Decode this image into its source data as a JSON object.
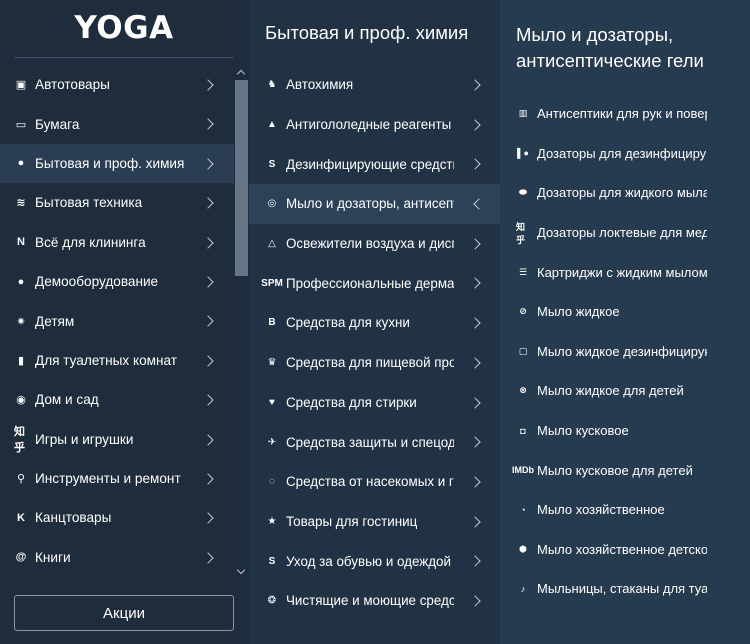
{
  "logo": {
    "text": "YOGA"
  },
  "categories": [
    {
      "label": "Автотовары",
      "icon": "twitch-icon",
      "glyph": "▣"
    },
    {
      "label": "Бумага",
      "icon": "cast-icon",
      "glyph": "▭"
    },
    {
      "label": "Бытовая и проф. химия",
      "icon": "swirl-icon",
      "glyph": "●",
      "active": true
    },
    {
      "label": "Бытовая техника",
      "icon": "wing-icon",
      "glyph": "≋"
    },
    {
      "label": "Всё для клининга",
      "icon": "n-icon",
      "glyph": "N"
    },
    {
      "label": "Демооборудование",
      "icon": "chat-icon",
      "glyph": "●"
    },
    {
      "label": "Детям",
      "icon": "ball-icon",
      "glyph": "✷"
    },
    {
      "label": "Для туалетных комнат",
      "icon": "chart-icon",
      "glyph": "▮"
    },
    {
      "label": "Дом и сад",
      "icon": "circle-logo-icon",
      "glyph": "◉"
    },
    {
      "label": "Игры и игрушки",
      "icon": "zhihu-icon",
      "glyph": "知乎"
    },
    {
      "label": "Инструменты и ремонт",
      "icon": "magnifier-icon",
      "glyph": "⚲"
    },
    {
      "label": "Канцтовары",
      "icon": "k-icon",
      "glyph": "K"
    },
    {
      "label": "Книги",
      "icon": "at-icon",
      "glyph": "@"
    }
  ],
  "promo_button": "Акции",
  "subcategory_title": "Бытовая и проф. химия",
  "subcategories": [
    {
      "label": "Автохимия",
      "icon": "horse-icon",
      "glyph": "♞"
    },
    {
      "label": "Антигололедные реагенты",
      "icon": "mountain-icon",
      "glyph": "▲"
    },
    {
      "label": "Дезинфицирующие средства",
      "icon": "s-icon",
      "glyph": "S"
    },
    {
      "label": "Мыло и дозаторы, антисептические гели",
      "icon": "target-icon",
      "glyph": "◎",
      "active": true
    },
    {
      "label": "Освежители воздуха и диспенсеры",
      "icon": "drive-icon",
      "glyph": "△"
    },
    {
      "label": "Профессиональные дерматологические средства",
      "icon": "spm-icon",
      "glyph": "SPM"
    },
    {
      "label": "Средства для кухни",
      "icon": "bold-b-icon",
      "glyph": "B"
    },
    {
      "label": "Средства для пищевой промышленности",
      "icon": "emblem-icon",
      "glyph": "♛"
    },
    {
      "label": "Средства для стирки",
      "icon": "heart-icon",
      "glyph": "♥"
    },
    {
      "label": "Средства защиты и спецодежда",
      "icon": "plane-icon",
      "glyph": "✈"
    },
    {
      "label": "Средства от насекомых и грызунов",
      "icon": "spiral-icon",
      "glyph": "◌"
    },
    {
      "label": "Товары для гостиниц",
      "icon": "star-icon",
      "glyph": "★"
    },
    {
      "label": "Уход за обувью и одеждой",
      "icon": "stack-s-icon",
      "glyph": "S"
    },
    {
      "label": "Чистящие и моющие средства",
      "icon": "gear-ring-icon",
      "glyph": "❂"
    }
  ],
  "detail_title": "Мыло и дозаторы, антисептические гели",
  "details": [
    {
      "label": "Антисептики для рук и поверхностей",
      "icon": "grid-icon",
      "glyph": "▥"
    },
    {
      "label": "Дозаторы для дезинфицирующих средств",
      "icon": "patreon-icon",
      "glyph": "▌●"
    },
    {
      "label": "Дозаторы для жидкого мыла",
      "icon": "bus-icon",
      "glyph": "⬬"
    },
    {
      "label": "Дозаторы локтевые для медицинских учреждений",
      "icon": "zhihu-icon",
      "glyph": "知乎"
    },
    {
      "label": "Картриджи с жидким мылом",
      "icon": "lines-icon",
      "glyph": "☰"
    },
    {
      "label": "Мыло жидкое",
      "icon": "compass-icon",
      "glyph": "⊘"
    },
    {
      "label": "Мыло жидкое дезинфицирующее",
      "icon": "box-icon",
      "glyph": "▢"
    },
    {
      "label": "Мыло жидкое для детей",
      "icon": "xbox-icon",
      "glyph": "⊗"
    },
    {
      "label": "Мыло кусковое",
      "icon": "square-dot-icon",
      "glyph": "◘"
    },
    {
      "label": "Мыло кусковое для детей",
      "icon": "imdb-icon",
      "glyph": "IMDb"
    },
    {
      "label": "Мыло хозяйственное",
      "icon": "swirl-icon",
      "glyph": "◔"
    },
    {
      "label": "Мыло хозяйственное детское",
      "icon": "hexagon-icon",
      "glyph": "⬢"
    },
    {
      "label": "Мыльницы, стаканы для туалетных принадлежностей",
      "icon": "deezer-icon",
      "glyph": "♪"
    }
  ],
  "colors": {
    "sidebar_bg": "#1e2c3c",
    "middle_bg": "#213245",
    "right_bg": "#263a50",
    "active_row": "#2a3d52",
    "scroll_thumb": "#667686"
  }
}
